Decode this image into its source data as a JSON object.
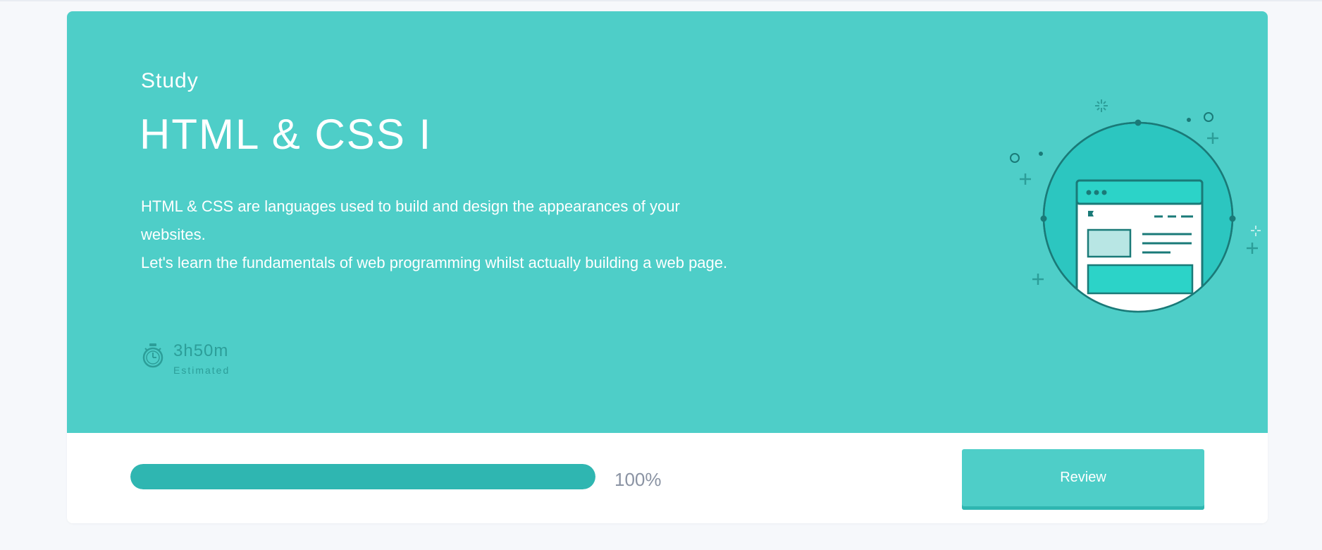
{
  "course": {
    "eyebrow": "Study",
    "title": "HTML & CSS I",
    "description_line1": "HTML & CSS are languages used to build and design the appearances of your websites.",
    "description_line2": "Let's learn the fundamentals of web programming whilst actually building a web page."
  },
  "estimate": {
    "time": "3h50m",
    "label": "Estimated",
    "icon": "stopwatch-icon"
  },
  "progress": {
    "percent_label": "100%",
    "fraction": 1.0
  },
  "actions": {
    "review_label": "Review"
  },
  "colors": {
    "hero_bg": "#4ecec8",
    "accent_dark": "#2fb6b1",
    "illustration_outline": "#1a7a78",
    "page_bg": "#f6f8fb"
  },
  "illustration": {
    "icon": "web-browser-illustration-icon"
  }
}
